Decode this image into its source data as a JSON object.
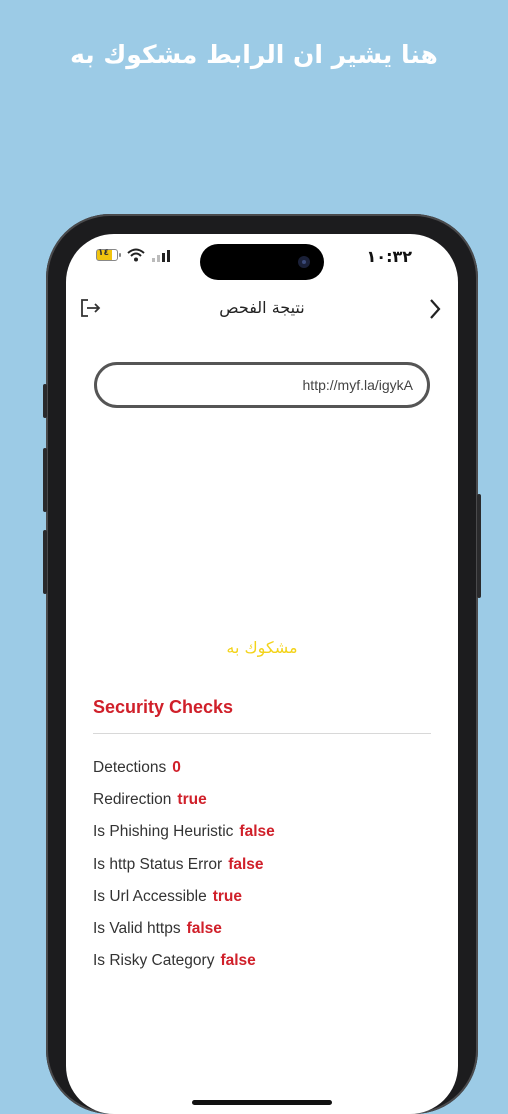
{
  "banner": {
    "text": "هنا يشير ان الرابط مشكوك به"
  },
  "status_bar": {
    "time": "١٠:٣٢",
    "battery_level": "١٤"
  },
  "header": {
    "title": "نتيجة الفحص",
    "left_icon": "logout-icon",
    "right_icon": "chevron-right-icon"
  },
  "url_field": {
    "value": "http://myf.la/igykA"
  },
  "verdict": {
    "text": "مشكوك به",
    "color": "#f3d31a"
  },
  "security": {
    "title": "Security Checks",
    "accent_color": "#d0202a",
    "checks": [
      {
        "label": "Detections",
        "value": "0"
      },
      {
        "label": "Redirection",
        "value": "true"
      },
      {
        "label": "Is Phishing Heuristic",
        "value": "false"
      },
      {
        "label": "Is http Status Error",
        "value": "false"
      },
      {
        "label": "Is Url Accessible",
        "value": "true"
      },
      {
        "label": "Is Valid https",
        "value": "false"
      },
      {
        "label": "Is Risky Category",
        "value": "false"
      }
    ]
  }
}
